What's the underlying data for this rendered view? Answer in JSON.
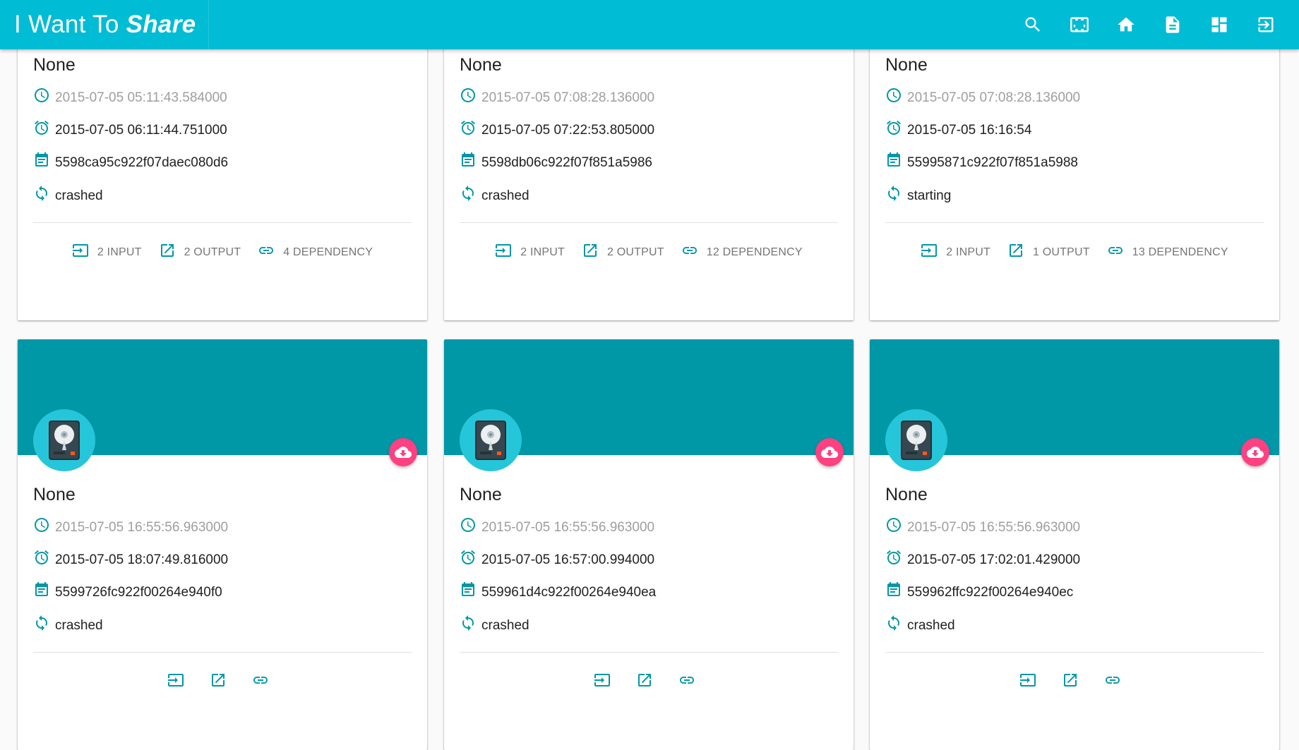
{
  "app": {
    "title_part1": "I Want To",
    "title_part2": "Share",
    "toolbar_icons": [
      "search-icon",
      "fullscreen-icon",
      "home-icon",
      "description-icon",
      "dashboard-icon",
      "exit-icon"
    ]
  },
  "colors": {
    "appbar": "#00bcd4",
    "card_header": "#0097a7",
    "avatar": "#26c6da",
    "fab": "#ff4081",
    "icon": "#0097a7"
  },
  "cards": [
    {
      "title": "None",
      "created": "2015-07-05 05:11:43.584000",
      "updated": "2015-07-05 06:11:44.751000",
      "id": "5598ca95c922f07daec080d6",
      "status": "crashed",
      "input": "2 INPUT",
      "output": "2 OUTPUT",
      "dependency": "4 DEPENDENCY"
    },
    {
      "title": "None",
      "created": "2015-07-05 07:08:28.136000",
      "updated": "2015-07-05 07:22:53.805000",
      "id": "5598db06c922f07f851a5986",
      "status": "crashed",
      "input": "2 INPUT",
      "output": "2 OUTPUT",
      "dependency": "12 DEPENDENCY"
    },
    {
      "title": "None",
      "created": "2015-07-05 07:08:28.136000",
      "updated": "2015-07-05 16:16:54",
      "id": "55995871c922f07f851a5988",
      "status": "starting",
      "input": "2 INPUT",
      "output": "1 OUTPUT",
      "dependency": "13 DEPENDENCY"
    },
    {
      "title": "None",
      "created": "2015-07-05 16:55:56.963000",
      "updated": "2015-07-05 18:07:49.816000",
      "id": "5599726fc922f00264e940f0",
      "status": "crashed",
      "input": "",
      "output": "",
      "dependency": ""
    },
    {
      "title": "None",
      "created": "2015-07-05 16:55:56.963000",
      "updated": "2015-07-05 16:57:00.994000",
      "id": "559961d4c922f00264e940ea",
      "status": "crashed",
      "input": "",
      "output": "",
      "dependency": ""
    },
    {
      "title": "None",
      "created": "2015-07-05 16:55:56.963000",
      "updated": "2015-07-05 17:02:01.429000",
      "id": "559962ffc922f00264e940ec",
      "status": "crashed",
      "input": "",
      "output": "",
      "dependency": ""
    }
  ]
}
